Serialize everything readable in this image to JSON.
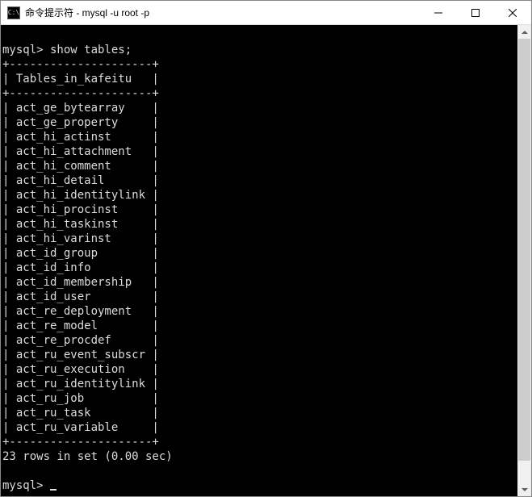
{
  "window": {
    "title": "命令提示符 - mysql  -u root -p",
    "icon_label": "cmd"
  },
  "terminal": {
    "prompt": "mysql>",
    "command": "show tables;",
    "header": "Tables_in_kafeitu",
    "border_top": "+---------------------+",
    "rows": [
      "act_ge_bytearray",
      "act_ge_property",
      "act_hi_actinst",
      "act_hi_attachment",
      "act_hi_comment",
      "act_hi_detail",
      "act_hi_identitylink",
      "act_hi_procinst",
      "act_hi_taskinst",
      "act_hi_varinst",
      "act_id_group",
      "act_id_info",
      "act_id_membership",
      "act_id_user",
      "act_re_deployment",
      "act_re_model",
      "act_re_procdef",
      "act_ru_event_subscr",
      "act_ru_execution",
      "act_ru_identitylink",
      "act_ru_job",
      "act_ru_task",
      "act_ru_variable"
    ],
    "summary": "23 rows in set (0.00 sec)"
  }
}
